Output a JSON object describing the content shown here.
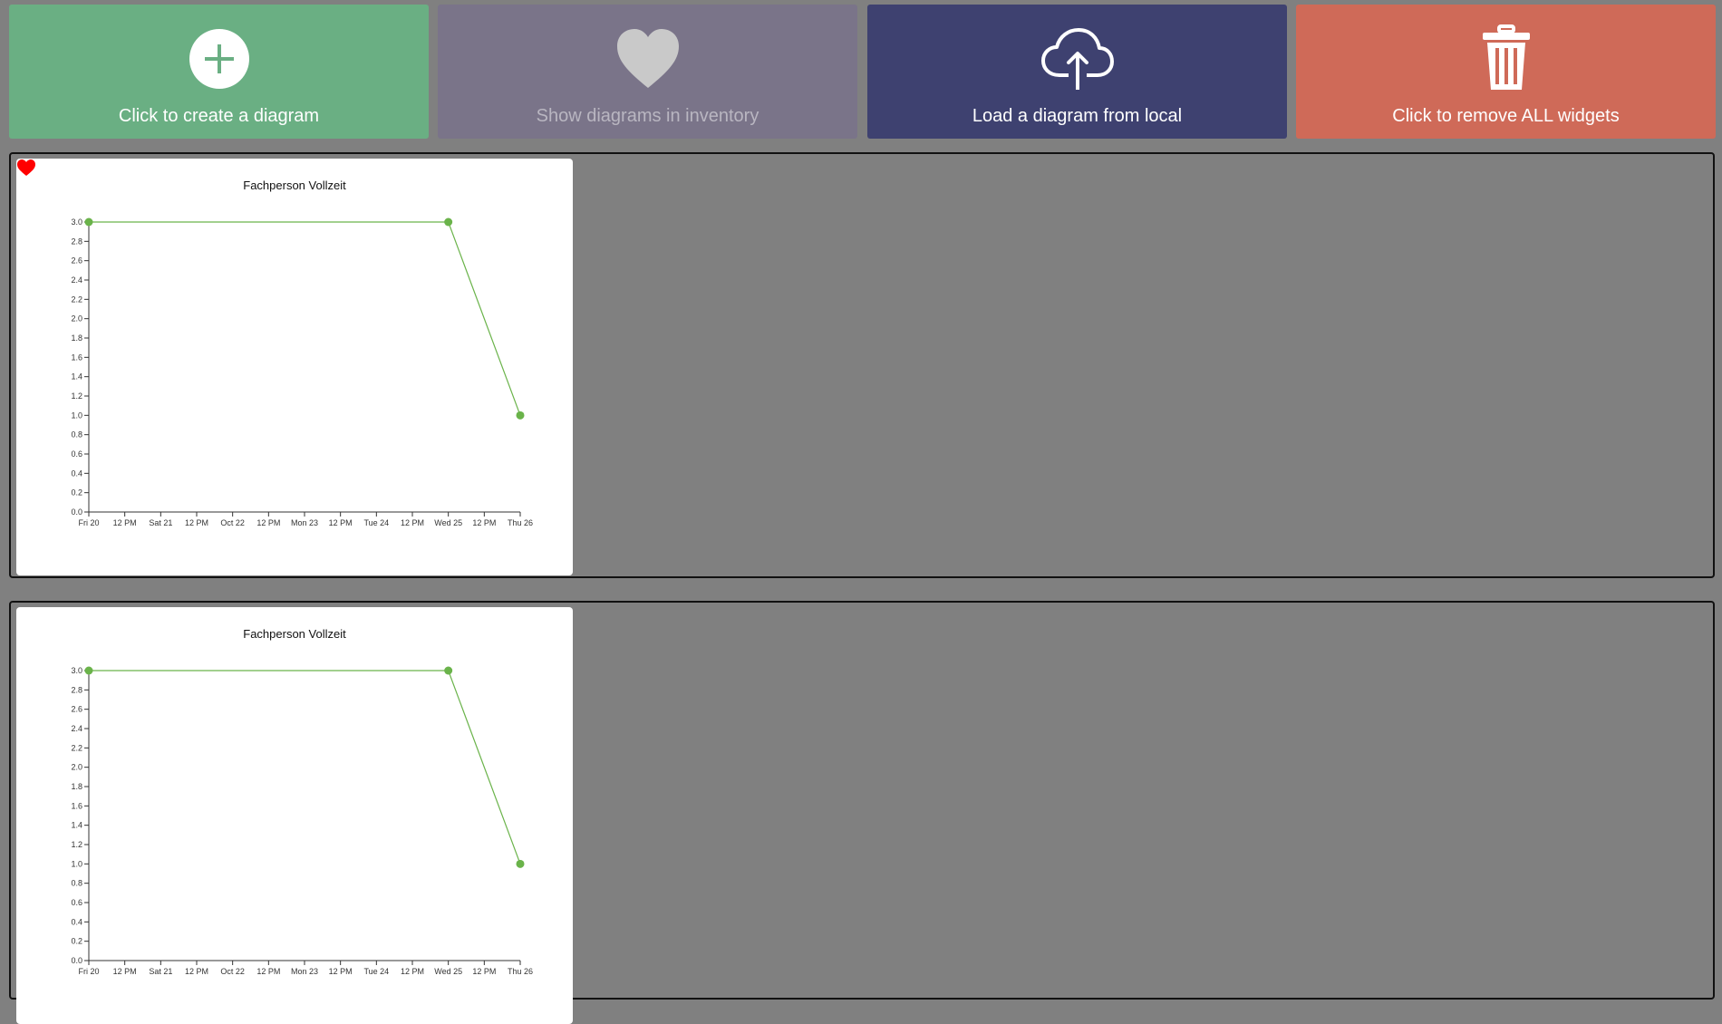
{
  "toolbar": {
    "create": {
      "label": "Click to create a diagram",
      "icon": "plus-circle-icon",
      "color": "#6aaf83"
    },
    "inventory": {
      "label": "Show diagrams in inventory",
      "icon": "heart-icon",
      "color": "#7a7489"
    },
    "load": {
      "label": "Load a diagram from local",
      "icon": "cloud-upload-icon",
      "color": "#3e4170"
    },
    "remove": {
      "label": "Click to remove ALL widgets",
      "icon": "trash-icon",
      "color": "#cf6a58"
    }
  },
  "widgets": [
    {
      "favorite": true,
      "favorite_color": "#ff0000"
    },
    {
      "favorite": false
    }
  ],
  "chart_data": [
    {
      "type": "line",
      "title": "Fachperson Vollzeit",
      "x": [
        "Fri 20",
        "Wed 25",
        "Thu 26"
      ],
      "x_positions": [
        0,
        5,
        6
      ],
      "series": [
        {
          "values": [
            3.0,
            3.0,
            1.0
          ],
          "color": "#6ab34a"
        }
      ],
      "x_tick_labels": [
        "Fri 20",
        "12 PM",
        "Sat 21",
        "12 PM",
        "Oct 22",
        "12 PM",
        "Mon 23",
        "12 PM",
        "Tue 24",
        "12 PM",
        "Wed 25",
        "12 PM",
        "Thu 26"
      ],
      "y_tick_labels": [
        "0.0",
        "0.2",
        "0.4",
        "0.6",
        "0.8",
        "1.0",
        "1.2",
        "1.4",
        "1.6",
        "1.8",
        "2.0",
        "2.2",
        "2.4",
        "2.6",
        "2.8",
        "3.0"
      ],
      "ylim": [
        0,
        3.0
      ],
      "grid": false,
      "xlabel": "",
      "ylabel": ""
    },
    {
      "type": "line",
      "title": "Fachperson Vollzeit",
      "x": [
        "Fri 20",
        "Wed 25",
        "Thu 26"
      ],
      "x_positions": [
        0,
        5,
        6
      ],
      "series": [
        {
          "values": [
            3.0,
            3.0,
            1.0
          ],
          "color": "#6ab34a"
        }
      ],
      "x_tick_labels": [
        "Fri 20",
        "12 PM",
        "Sat 21",
        "12 PM",
        "Oct 22",
        "12 PM",
        "Mon 23",
        "12 PM",
        "Tue 24",
        "12 PM",
        "Wed 25",
        "12 PM",
        "Thu 26"
      ],
      "y_tick_labels": [
        "0.0",
        "0.2",
        "0.4",
        "0.6",
        "0.8",
        "1.0",
        "1.2",
        "1.4",
        "1.6",
        "1.8",
        "2.0",
        "2.2",
        "2.4",
        "2.6",
        "2.8",
        "3.0"
      ],
      "ylim": [
        0,
        3.0
      ],
      "grid": false,
      "xlabel": "",
      "ylabel": ""
    }
  ]
}
